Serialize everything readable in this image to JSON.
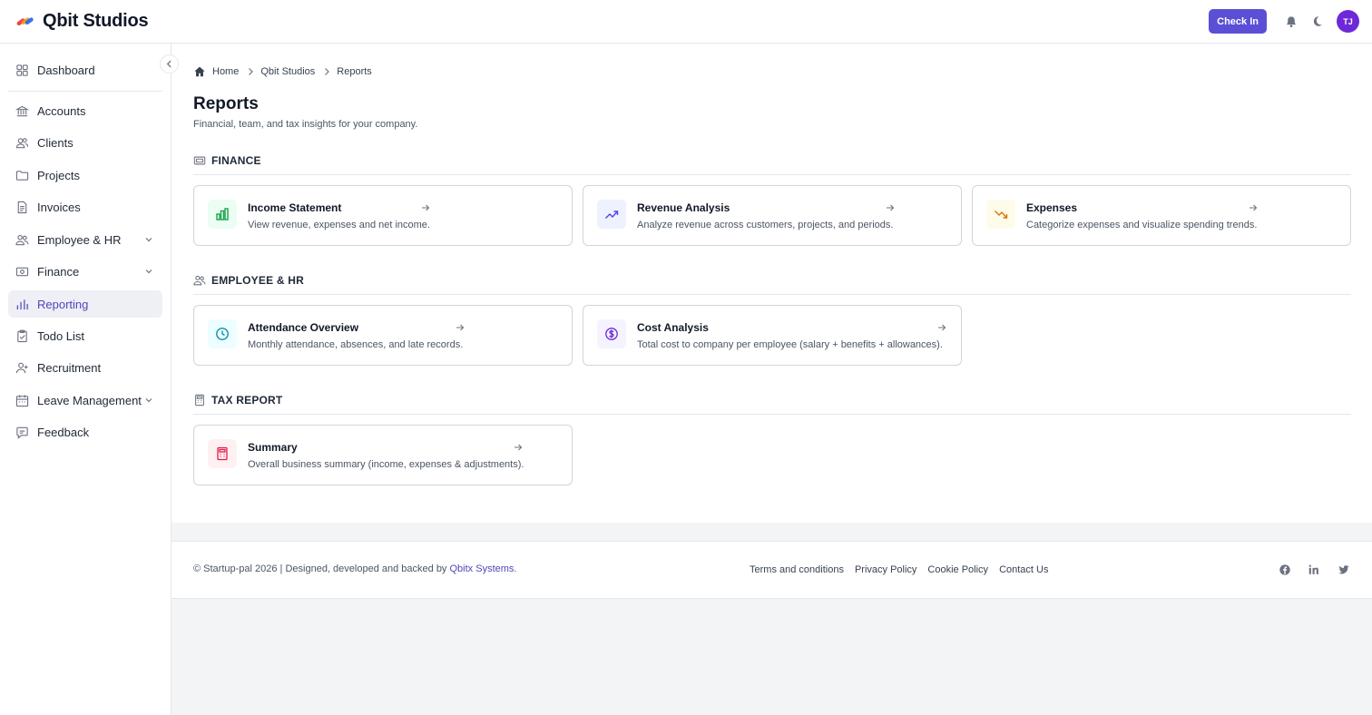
{
  "app": {
    "name": "Qbit Studios"
  },
  "header": {
    "checkin_label": "Check In",
    "avatar_initials": "TJ"
  },
  "sidebar": {
    "items": [
      {
        "label": "Dashboard",
        "icon": "grid-icon"
      },
      {
        "label": "Accounts",
        "icon": "bank-icon"
      },
      {
        "label": "Clients",
        "icon": "users-icon"
      },
      {
        "label": "Projects",
        "icon": "folder-icon"
      },
      {
        "label": "Invoices",
        "icon": "file-icon"
      },
      {
        "label": "Employee & HR",
        "icon": "people-icon",
        "expandable": true
      },
      {
        "label": "Finance",
        "icon": "money-icon",
        "expandable": true
      },
      {
        "label": "Reporting",
        "icon": "bar-chart-icon",
        "active": true
      },
      {
        "label": "Todo List",
        "icon": "clipboard-icon"
      },
      {
        "label": "Recruitment",
        "icon": "user-plus-icon"
      },
      {
        "label": "Leave Management",
        "icon": "calendar-icon",
        "expandable": true
      },
      {
        "label": "Feedback",
        "icon": "chat-icon"
      }
    ]
  },
  "breadcrumb": {
    "home": "Home",
    "company": "Qbit Studios",
    "current": "Reports"
  },
  "page": {
    "title": "Reports",
    "subtitle": "Financial, team, and tax insights for your company."
  },
  "sections": [
    {
      "title": "FINANCE",
      "cards": [
        {
          "title": "Income Statement",
          "desc": "View revenue, expenses and net income.",
          "icon": "bar-chart-icon",
          "color": "#16a34a",
          "bg": "#ecfdf3"
        },
        {
          "title": "Revenue Analysis",
          "desc": "Analyze revenue across customers, projects, and periods.",
          "icon": "trending-up-icon",
          "color": "#4f46e5",
          "bg": "#eef2ff"
        },
        {
          "title": "Expenses",
          "desc": "Categorize expenses and visualize spending trends.",
          "icon": "trending-down-icon",
          "color": "#d97706",
          "bg": "#fffbeb"
        }
      ]
    },
    {
      "title": "EMPLOYEE & HR",
      "cards": [
        {
          "title": "Attendance Overview",
          "desc": "Monthly attendance, absences, and late records.",
          "icon": "clock-icon",
          "color": "#0891b2",
          "bg": "#ecfeff"
        },
        {
          "title": "Cost Analysis",
          "desc": "Total cost to company per employee (salary + benefits + allowances).",
          "icon": "dollar-circle-icon",
          "color": "#6d28d9",
          "bg": "#f5f3ff"
        }
      ]
    },
    {
      "title": "TAX REPORT",
      "cards": [
        {
          "title": "Summary",
          "desc": "Overall business summary (income, expenses & adjustments).",
          "icon": "calculator-icon",
          "color": "#e11d48",
          "bg": "#fff1f2"
        }
      ]
    }
  ],
  "footer": {
    "copyright": "© Startup-pal 2026 | Designed, developed and backed by ",
    "brand_link": "Qbitx Systems",
    "copyright_end": ".",
    "links": [
      "Terms and conditions",
      "Privacy Policy",
      "Cookie Policy",
      "Contact Us"
    ],
    "social": [
      "facebook-icon",
      "linkedin-icon",
      "twitter-icon"
    ]
  },
  "colors": {
    "accent": "#5b4fd6",
    "active_bg": "#eef0f6",
    "active_text": "#4f46b8"
  }
}
